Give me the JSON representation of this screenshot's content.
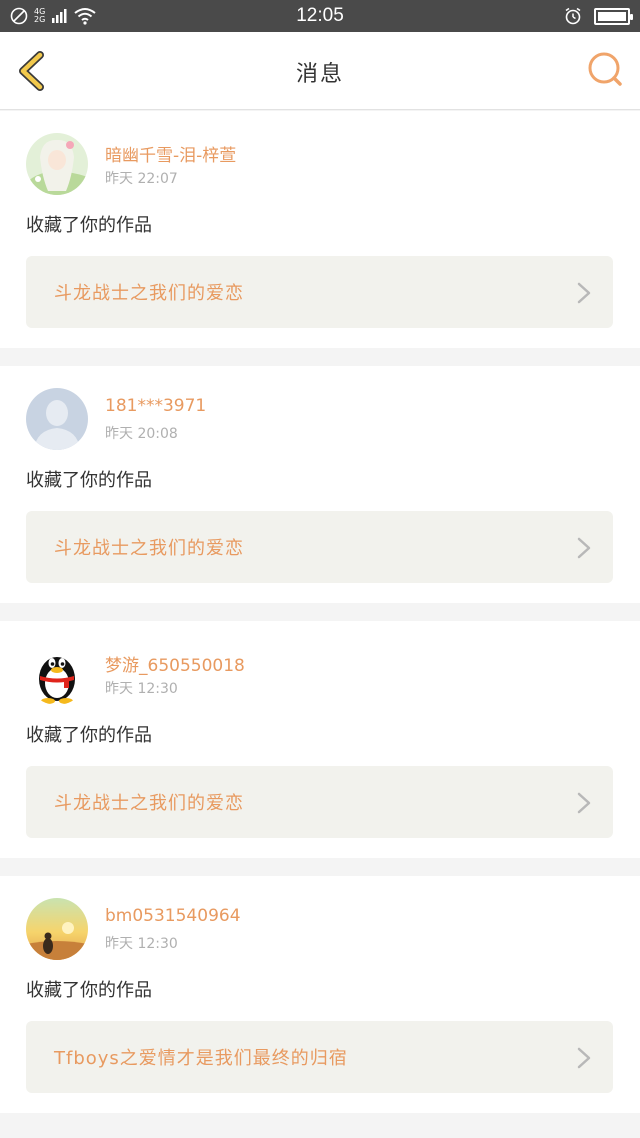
{
  "status_bar": {
    "network_top": "4G",
    "network_bottom": "2G",
    "time": "12:05"
  },
  "header": {
    "title": "消息",
    "back_icon": "chevron-left-icon",
    "search_icon": "search-icon"
  },
  "colors": {
    "accent": "#e89a60",
    "back_arrow": "#f2c94c",
    "card_bg": "#ffffff",
    "work_bg": "#f2f2ed",
    "page_bg": "#f4f4f4"
  },
  "messages": [
    {
      "user": "暗幽千雪-泪-梓萱",
      "time": "昨天 22:07",
      "action": "收藏了你的作品",
      "work_title": "斗龙战士之我们的爱恋",
      "avatar": "anime-girl-avatar"
    },
    {
      "user": "181***3971",
      "time": "昨天 20:08",
      "action": "收藏了你的作品",
      "work_title": "斗龙战士之我们的爱恋",
      "avatar": "default-user-avatar"
    },
    {
      "user": "梦游_650550018",
      "time": "昨天 12:30",
      "action": "收藏了你的作品",
      "work_title": "斗龙战士之我们的爱恋",
      "avatar": "qq-penguin-avatar"
    },
    {
      "user": "bm0531540964",
      "time": "昨天 12:30",
      "action": "收藏了你的作品",
      "work_title": "Tfboys之爱情才是我们最终的归宿",
      "avatar": "sunset-avatar"
    }
  ]
}
